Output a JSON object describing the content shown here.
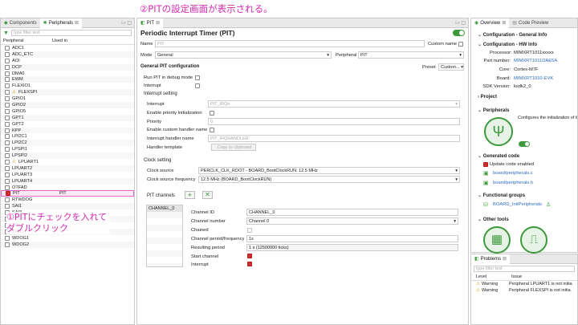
{
  "annotations": {
    "top": "②PITの設定画面が表示される。",
    "left_line1": "①PITにチェックを入れて",
    "left_line2": "ダブルクリック"
  },
  "left_panel": {
    "tabs": [
      "Components",
      "Peripherals"
    ],
    "filter_placeholder": "type filter text",
    "col_peripheral": "Peripheral",
    "col_used_in": "Used in",
    "items": [
      {
        "name": "ADC1",
        "checked": false,
        "warn": false,
        "used": ""
      },
      {
        "name": "ADC_ETC",
        "checked": false,
        "warn": false,
        "used": ""
      },
      {
        "name": "AOI",
        "checked": false,
        "warn": false,
        "used": ""
      },
      {
        "name": "DCP",
        "checked": false,
        "warn": false,
        "used": ""
      },
      {
        "name": "DMA0",
        "checked": false,
        "warn": false,
        "used": ""
      },
      {
        "name": "EWM",
        "checked": false,
        "warn": false,
        "used": ""
      },
      {
        "name": "FLEXIO1",
        "checked": false,
        "warn": false,
        "used": ""
      },
      {
        "name": "FLEXSPI",
        "checked": false,
        "warn": true,
        "used": ""
      },
      {
        "name": "GPIO1",
        "checked": false,
        "warn": false,
        "used": ""
      },
      {
        "name": "GPIO2",
        "checked": false,
        "warn": false,
        "used": ""
      },
      {
        "name": "GPIO5",
        "checked": false,
        "warn": false,
        "used": ""
      },
      {
        "name": "GPT1",
        "checked": false,
        "warn": false,
        "used": ""
      },
      {
        "name": "GPT2",
        "checked": false,
        "warn": false,
        "used": ""
      },
      {
        "name": "KPP",
        "checked": false,
        "warn": false,
        "used": ""
      },
      {
        "name": "LPI2C1",
        "checked": false,
        "warn": false,
        "used": ""
      },
      {
        "name": "LPI2C2",
        "checked": false,
        "warn": false,
        "used": ""
      },
      {
        "name": "LPSPI1",
        "checked": false,
        "warn": false,
        "used": ""
      },
      {
        "name": "LPSPI2",
        "checked": false,
        "warn": false,
        "used": ""
      },
      {
        "name": "LPUART1",
        "checked": false,
        "warn": true,
        "used": ""
      },
      {
        "name": "LPUART2",
        "checked": false,
        "warn": false,
        "used": ""
      },
      {
        "name": "LPUART3",
        "checked": false,
        "warn": false,
        "used": ""
      },
      {
        "name": "LPUART4",
        "checked": false,
        "warn": false,
        "used": ""
      },
      {
        "name": "OTFAD",
        "checked": false,
        "warn": false,
        "used": ""
      },
      {
        "name": "PIT",
        "checked": true,
        "warn": false,
        "used": "PIT"
      },
      {
        "name": "RTWDOG",
        "checked": false,
        "warn": false,
        "used": ""
      },
      {
        "name": "SAI1",
        "checked": false,
        "warn": false,
        "used": ""
      },
      {
        "name": "SAI3",
        "checked": false,
        "warn": false,
        "used": ""
      },
      {
        "name": "SPDIF",
        "checked": false,
        "warn": false,
        "used": ""
      },
      {
        "name": "SRC",
        "checked": false,
        "warn": false,
        "used": ""
      },
      {
        "name": "TRNG",
        "checked": false,
        "warn": false,
        "used": ""
      },
      {
        "name": "WDOG1",
        "checked": false,
        "warn": false,
        "used": ""
      },
      {
        "name": "WDOG2",
        "checked": false,
        "warn": false,
        "used": ""
      }
    ]
  },
  "editor": {
    "tab": "PIT",
    "title": "Periodic Interrupt Timer (PIT)",
    "name_label": "Name",
    "name_value": "PIT",
    "custom_name_label": "Custom name",
    "mode_label": "Mode",
    "mode_value": "General",
    "peripheral_label": "Peripheral",
    "peripheral_value": "PIT",
    "general_config": "General PIT configuration",
    "preset_label": "Preset",
    "preset_value": "Custom...",
    "run_debug": "Run PIT in debug mode",
    "interrupt": "Interrupt",
    "interrupt_setting": "Interrupt setting",
    "int_interrupt_label": "Interrupt",
    "int_interrupt_value": "PIT_IRQn",
    "enable_priority": "Enable priority initialization",
    "priority_label": "Priority",
    "priority_value": "0",
    "enable_custom_handler": "Enable custom handler name",
    "handler_name_label": "Interrupt handler name",
    "handler_name_value": "PIT_IRQHANDLER",
    "handler_template": "Handler template",
    "copy_clipboard": "Copy to clipboard",
    "clock_setting": "Clock setting",
    "clock_source_label": "Clock source",
    "clock_source_value": "PERCLK_CLK_ROOT - BOARD_BootClockRUN: 12.5 MHz",
    "clock_freq_label": "Clock source frequency",
    "clock_freq_value": "12.5 MHz (BOARD_BootClockRUN)",
    "pit_channels": "PIT channels",
    "channel_item": "CHANNEL_0",
    "channel_id_label": "Channel ID",
    "channel_id_value": "CHANNEL_0",
    "channel_number_label": "Channel number",
    "channel_number_value": "Channel 0",
    "chained_label": "Chained",
    "period_label": "Channel period/frequency",
    "period_value": "1s",
    "resulting_label": "Resulting period",
    "resulting_value": "1 s (12500000 ticks)",
    "start_label": "Start channel",
    "ch_interrupt_label": "Interrupt"
  },
  "right_panel": {
    "tabs": [
      "Overview",
      "Code Preview"
    ],
    "config_general": "Configuration - General Info",
    "config_hw": "Configuration - HW Info",
    "processor_label": "Processor:",
    "processor_value": "MIMXRT1011xxxxx",
    "part_label": "Part number:",
    "part_value": "MIMXRT1011DAE5A",
    "core_label": "Core:",
    "core_value": "Cortex-M7F",
    "board_label": "Board:",
    "board_value": "MIMXRT1010-EVK",
    "sdk_label": "SDK Version:",
    "sdk_value": "ksdk2_0",
    "project": "Project",
    "peripherals": "Peripherals",
    "peripherals_desc": "Configures the initialization of th",
    "generated_code": "Generated code",
    "update_code": "Update code enabled",
    "file_c": "board/peripherals.c",
    "file_h": "board/peripherals.h",
    "functional_groups": "Functional groups",
    "func_name": "BOARD_InitPeripherals",
    "other_tools": "Other tools"
  },
  "problems": {
    "tab": "Problems",
    "filter_placeholder": "type filter text",
    "col_level": "Level",
    "col_issue": "Issue",
    "rows": [
      {
        "level": "Warning",
        "issue": "Peripheral LPUART1 is not initia"
      },
      {
        "level": "Warning",
        "issue": "Peripheral FLEXSPI is not initia"
      }
    ]
  },
  "colors": {
    "annotation": "#d12bb0",
    "accent_green": "#3c9a3c",
    "link_blue": "#2b6bbf",
    "check_red": "#d32f2f"
  }
}
